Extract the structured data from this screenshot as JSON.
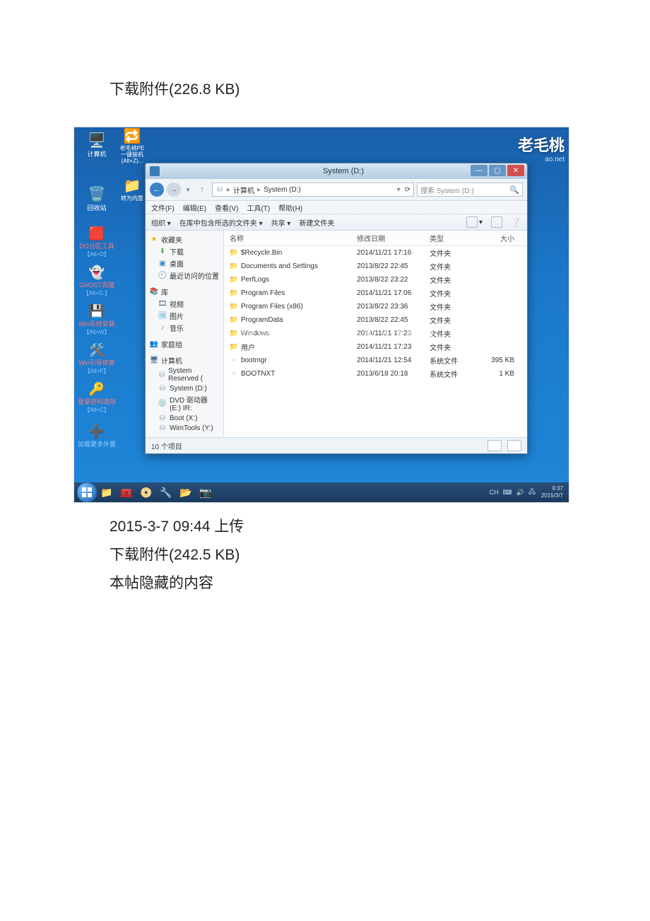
{
  "top_download": "下载附件(226.8 KB)",
  "below": {
    "line1": "2015-3-7 09:44 上传",
    "line2": "下载附件(242.5 KB)",
    "line3": "本帖隐藏的内容"
  },
  "brand": "老毛桃",
  "brand_sub": "ao.net",
  "desk": {
    "computer": "计算机",
    "pe": "老毛桃PE一键装机(Alt+Z)...",
    "recycle": "回收站",
    "trans": "转为内置",
    "dg": {
      "label": "DG分区工具",
      "key": "【Alt+D】"
    },
    "ghost": {
      "label": "GHOST克隆",
      "key": "【Alt+G 】"
    },
    "winsys": {
      "label": "Win系统安装",
      "key": "【Alt+W】"
    },
    "winboot": {
      "label": "Win引导修复",
      "key": "【Alt+F】"
    },
    "pwd": {
      "label": "登录密码清除",
      "key": "【Alt+C】"
    },
    "more": "加载更多外置"
  },
  "explorer": {
    "title": "System (D:)",
    "addr": {
      "root": "计算机",
      "cur": "System (D:)"
    },
    "search_ph": "搜索 System (D:)",
    "refresh": "⟳",
    "menu": {
      "file": "文件(F)",
      "edit": "编辑(E)",
      "view": "查看(V)",
      "tools": "工具(T)",
      "help": "帮助(H)"
    },
    "toolbar": {
      "org": "组织 ▾",
      "lib": "在库中包含所选的文件夹 ▾",
      "share": "共享 ▾",
      "newf": "新建文件夹",
      "view_tip": "视图",
      "preview_tip": "预览",
      "help_tip": "帮助"
    },
    "cols": {
      "name": "名称",
      "date": "修改日期",
      "type": "类型",
      "size": "大小"
    },
    "side": {
      "fav": "收藏夹",
      "download": "下载",
      "desktop": "桌面",
      "recent": "最近访问的位置",
      "libs": "库",
      "video": "视频",
      "pic": "图片",
      "music": "音乐",
      "home": "家庭组",
      "computer": "计算机",
      "sysres": "System Reserved (",
      "sysd": "System (D:)",
      "dvd": "DVD 驱动器 (E:) IR:",
      "boot": "Boot (X:)",
      "wim": "WimTools (Y:)"
    },
    "rows": [
      {
        "name": "$Recycle.Bin",
        "date": "2014/11/21 17:16",
        "type": "文件夹",
        "size": ""
      },
      {
        "name": "Documents and Settings",
        "date": "2013/8/22 22:45",
        "type": "文件夹",
        "size": ""
      },
      {
        "name": "PerfLogs",
        "date": "2013/8/22 23:22",
        "type": "文件夹",
        "size": ""
      },
      {
        "name": "Program Files",
        "date": "2014/11/21 17:06",
        "type": "文件夹",
        "size": ""
      },
      {
        "name": "Program Files (x86)",
        "date": "2013/8/22 23:36",
        "type": "文件夹",
        "size": ""
      },
      {
        "name": "ProgramData",
        "date": "2013/8/22 22:45",
        "type": "文件夹",
        "size": ""
      },
      {
        "name": "Windows",
        "date": "2014/11/21 17:23",
        "type": "文件夹",
        "size": ""
      },
      {
        "name": "用户",
        "date": "2014/11/21 17:23",
        "type": "文件夹",
        "size": ""
      },
      {
        "name": "bootmgr",
        "date": "2014/11/21 12:54",
        "type": "系统文件",
        "size": "395 KB"
      },
      {
        "name": "BOOTNXT",
        "date": "2013/6/18 20:18",
        "type": "系统文件",
        "size": "1 KB"
      }
    ],
    "status": "10 个项目",
    "watermark": "www.bdocx.com"
  },
  "taskbar": {
    "lang": "CH",
    "time": "9:37",
    "date": "2015/3/7"
  }
}
